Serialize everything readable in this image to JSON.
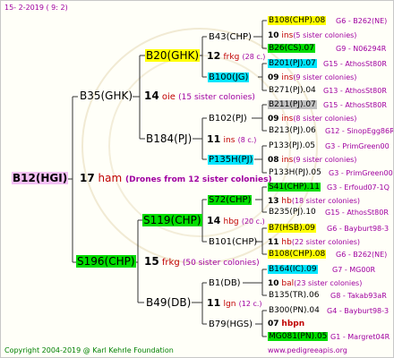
{
  "header": {
    "date": "15-  2-2019 (  9:  2)"
  },
  "footer": {
    "copyright": "Copyright 2004-2019 @ Karl Kehrle Foundation",
    "site": "www.pedigreeapis.org"
  },
  "root": {
    "name": "B12(HGI)",
    "num": "17",
    "tag": "ham",
    "note": "(Drones from 12 sister colonies)"
  },
  "sire": {
    "name": "B35(GHK)",
    "num": "14",
    "tag": "oie",
    "note": "(15 sister colonies)"
  },
  "dam": {
    "name": "S196(CHP)",
    "num": "15",
    "tag": "frkg",
    "note": "(50 sister colonies)"
  },
  "g3": [
    {
      "name": "B20(GHK)",
      "num": "12",
      "tag": "frkg",
      "note": "(28 c.)"
    },
    {
      "name": "B184(PJ)",
      "num": "11",
      "tag": "ins",
      "note": "(8 c.)"
    },
    {
      "name": "S119(CHP)",
      "num": "14",
      "tag": "hbg",
      "note": "(20 c.)"
    },
    {
      "name": "B49(DB)",
      "num": "11",
      "tag": "lgn",
      "note": "(12 c.)"
    }
  ],
  "g4": [
    {
      "name": "B43(CHP)"
    },
    {
      "name": "B100(JG)"
    },
    {
      "name": "B102(PJ)"
    },
    {
      "name": "P135H(PJ)"
    },
    {
      "name": "S72(CHP)"
    },
    {
      "name": "B101(CHP)"
    },
    {
      "name": "B1(DB)"
    },
    {
      "name": "B79(HGS)"
    }
  ],
  "g5": [
    {
      "name": "B108(CHP).08",
      "info": "G6 - B262(NE)"
    },
    {
      "num": "10",
      "tag": "ins",
      "note": "(5 sister colonies)"
    },
    {
      "name": "B26(CS).07",
      "info": "G9 - N06294R"
    },
    {
      "name": "B201(PJ).07",
      "info": "G15 - AthosSt80R"
    },
    {
      "num": "09",
      "tag": "ins",
      "note": "(9 sister colonies)"
    },
    {
      "name": "B271(PJ).04",
      "info": "G13 - AthosSt80R"
    },
    {
      "name": "B211(PJ).07",
      "info": "G15 - AthosSt80R"
    },
    {
      "num": "09",
      "tag": "ins",
      "note": "(8 sister colonies)"
    },
    {
      "name": "B213(PJ).06",
      "info": "G12 - SinopEgg86R"
    },
    {
      "name": "P133(PJ).05",
      "info": "G3 - PrimGreen00"
    },
    {
      "num": "08",
      "tag": "ins",
      "note": "(9 sister colonies)"
    },
    {
      "name": "P133H(PJ).05",
      "info": "G3 - PrimGreen00"
    },
    {
      "name": "S41(CHP).11",
      "info": "G3 - Erfoud07-1Q"
    },
    {
      "num": "13",
      "tag": "hb",
      "note": "(18 sister colonies)"
    },
    {
      "name": "B235(PJ).10",
      "info": "G15 - AthosSt80R"
    },
    {
      "name": "B7(HSB).09",
      "info": "G6 - Bayburt98-3"
    },
    {
      "num": "11",
      "tag": "hb",
      "note": "(22 sister colonies)"
    },
    {
      "name": "B108(CHP).08",
      "info": "G6 - B262(NE)"
    },
    {
      "name": "B164(IC).09",
      "info": "G7 - MG00R"
    },
    {
      "num": "10",
      "tag": "bal",
      "note": "(23 sister colonies)"
    },
    {
      "name": "B135(TR).06",
      "info": "G8 - Takab93aR"
    },
    {
      "name": "B300(PN).04",
      "info": "G4 - Bayburt98-3"
    },
    {
      "num": "07",
      "tag": "hbpn",
      "note": ""
    },
    {
      "name": "MG081(PN).05",
      "info": "G1 - Margret04R"
    }
  ]
}
